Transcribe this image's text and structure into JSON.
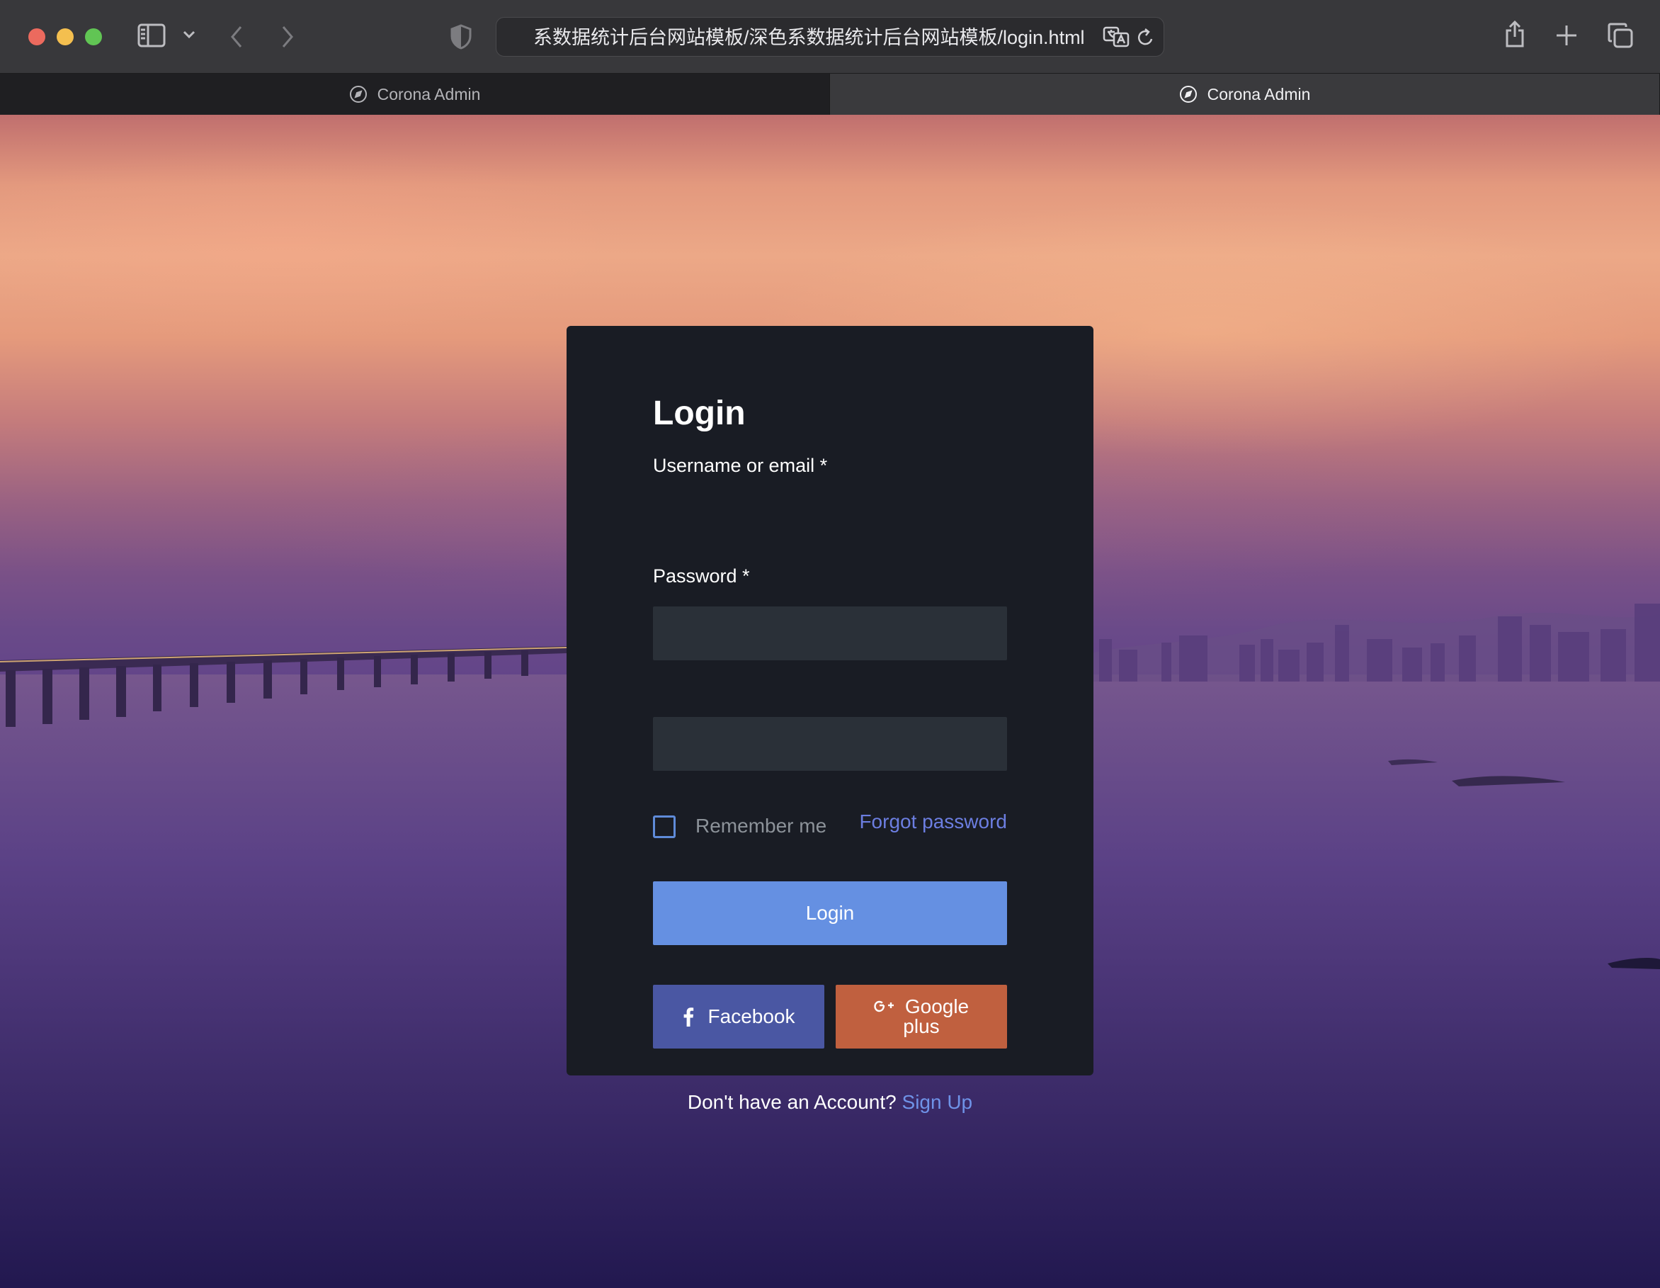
{
  "browser": {
    "url": "系数据统计后台网站模板/深色系数据统计后台网站模板/login.html",
    "tabs": [
      {
        "label": "Corona Admin",
        "active": false
      },
      {
        "label": "Corona Admin",
        "active": true
      }
    ]
  },
  "login": {
    "title": "Login",
    "username_label": "Username or email *",
    "username_value": "",
    "password_label": "Password *",
    "password_value": "",
    "remember_label": "Remember me",
    "remember_checked": false,
    "forgot_label": "Forgot password",
    "submit_label": "Login",
    "facebook_label": "Facebook",
    "google_label_line1": "Google",
    "google_label_line2": "plus",
    "signup_prompt": "Don't have an Account?",
    "signup_link": "Sign Up"
  },
  "colors": {
    "card_bg": "#191c24",
    "input_bg": "#2a3038",
    "primary": "#6590e2",
    "facebook": "#4a57a3",
    "google": "#c0603f",
    "link": "#6c7ee1"
  },
  "icons": {
    "tab_icon": "compass-icon",
    "facebook_icon": "facebook-f-icon",
    "google_icon": "google-plus-icon"
  }
}
